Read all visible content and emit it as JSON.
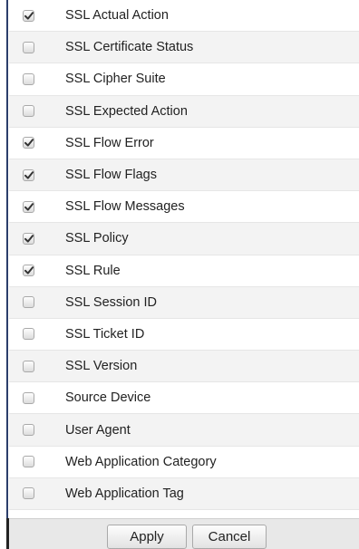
{
  "columns": [
    {
      "label": "SSL Actual Action",
      "checked": true
    },
    {
      "label": "SSL Certificate Status",
      "checked": false
    },
    {
      "label": "SSL Cipher Suite",
      "checked": false
    },
    {
      "label": "SSL Expected Action",
      "checked": false
    },
    {
      "label": "SSL Flow Error",
      "checked": true
    },
    {
      "label": "SSL Flow Flags",
      "checked": true
    },
    {
      "label": "SSL Flow Messages",
      "checked": true
    },
    {
      "label": "SSL Policy",
      "checked": true
    },
    {
      "label": "SSL Rule",
      "checked": true
    },
    {
      "label": "SSL Session ID",
      "checked": false
    },
    {
      "label": "SSL Ticket ID",
      "checked": false
    },
    {
      "label": "SSL Version",
      "checked": false
    },
    {
      "label": "Source Device",
      "checked": false
    },
    {
      "label": "User Agent",
      "checked": false
    },
    {
      "label": "Web Application Category",
      "checked": false
    },
    {
      "label": "Web Application Tag",
      "checked": false
    }
  ],
  "footer": {
    "apply_label": "Apply",
    "cancel_label": "Cancel"
  },
  "colors": {
    "accent_rule": "#2b3e6b",
    "check_mark": "#333333",
    "row_alt": "#f3f3f3",
    "footer_bg": "#e8e8e8"
  },
  "icons": {
    "checkbox_checked": "check-icon"
  }
}
